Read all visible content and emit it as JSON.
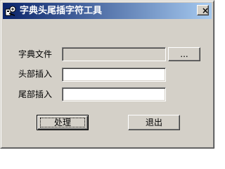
{
  "window": {
    "title": "字典头尾插字符工具",
    "close_label": "×"
  },
  "form": {
    "dict_file": {
      "label": "字典文件",
      "value": "",
      "browse_label": "..."
    },
    "head_insert": {
      "label": "头部插入",
      "value": ""
    },
    "tail_insert": {
      "label": "尾部插入",
      "value": ""
    }
  },
  "buttons": {
    "process_label": "处理",
    "exit_label": "退出"
  }
}
